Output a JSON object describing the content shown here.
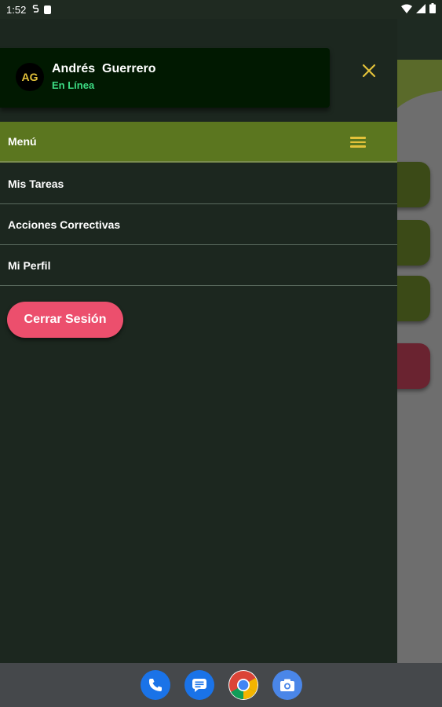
{
  "status_bar": {
    "time": "1:52",
    "icons": [
      "notification-s-icon",
      "sd-card-icon",
      "wifi-icon",
      "signal-icon",
      "battery-icon"
    ]
  },
  "drawer": {
    "profile": {
      "initials": "AG",
      "name": "Andrés  Guerrero",
      "status": "En Línea"
    },
    "close_icon": "close-icon",
    "menu_header": {
      "label": "Menú",
      "icon": "hamburger-icon"
    },
    "items": [
      {
        "label": "Mis Tareas"
      },
      {
        "label": "Acciones Correctivas"
      },
      {
        "label": "Mi Perfil"
      }
    ],
    "logout_label": "Cerrar Sesión"
  },
  "dock": {
    "apps": [
      "phone-icon",
      "messages-icon",
      "chrome-icon",
      "camera-icon"
    ]
  },
  "colors": {
    "drawer_bg": "#1c271f",
    "profile_card_bg": "#011901",
    "menu_header_bg": "#5b761f",
    "accent_yellow": "#e3c23a",
    "online_green": "#3ddc84",
    "logout_pink": "#ec4f6d"
  }
}
